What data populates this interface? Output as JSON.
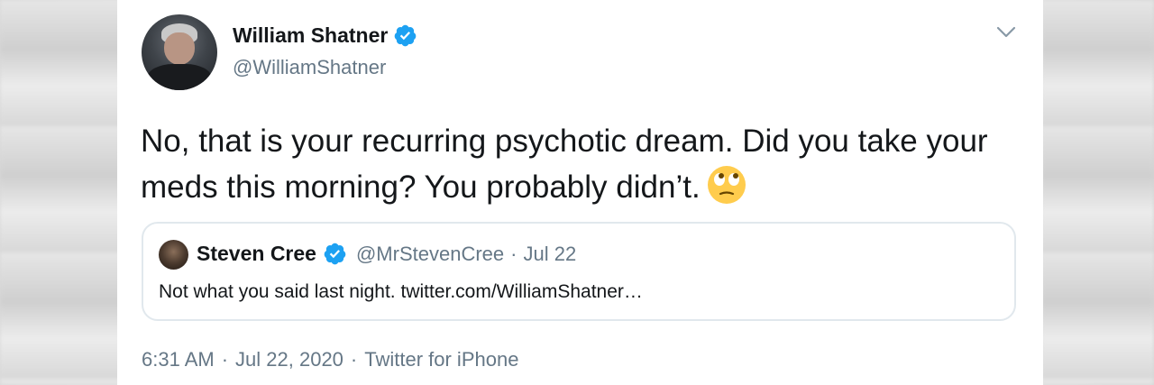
{
  "tweet": {
    "author": {
      "display_name": "William Shatner",
      "handle": "@WilliamShatner",
      "verified": true
    },
    "text": "No, that is your recurring psychotic dream. Did you take your meds this morning? You probably didn’t.",
    "emoji": "face-with-rolling-eyes",
    "menu_icon": "chevron-down-icon",
    "quoted": {
      "display_name": "Steven Cree",
      "handle": "@MrStevenCree",
      "separator": "·",
      "date": "Jul 22",
      "verified": true,
      "text": "Not what you said last night. twitter.com/WilliamShatner…"
    },
    "meta": {
      "time": "6:31 AM",
      "separator": "·",
      "date": "Jul 22, 2020",
      "source": "Twitter for iPhone"
    }
  },
  "colors": {
    "text_primary": "#14171a",
    "text_secondary": "#657786",
    "verified_blue": "#1da1f2",
    "border": "#e1e8ed"
  }
}
